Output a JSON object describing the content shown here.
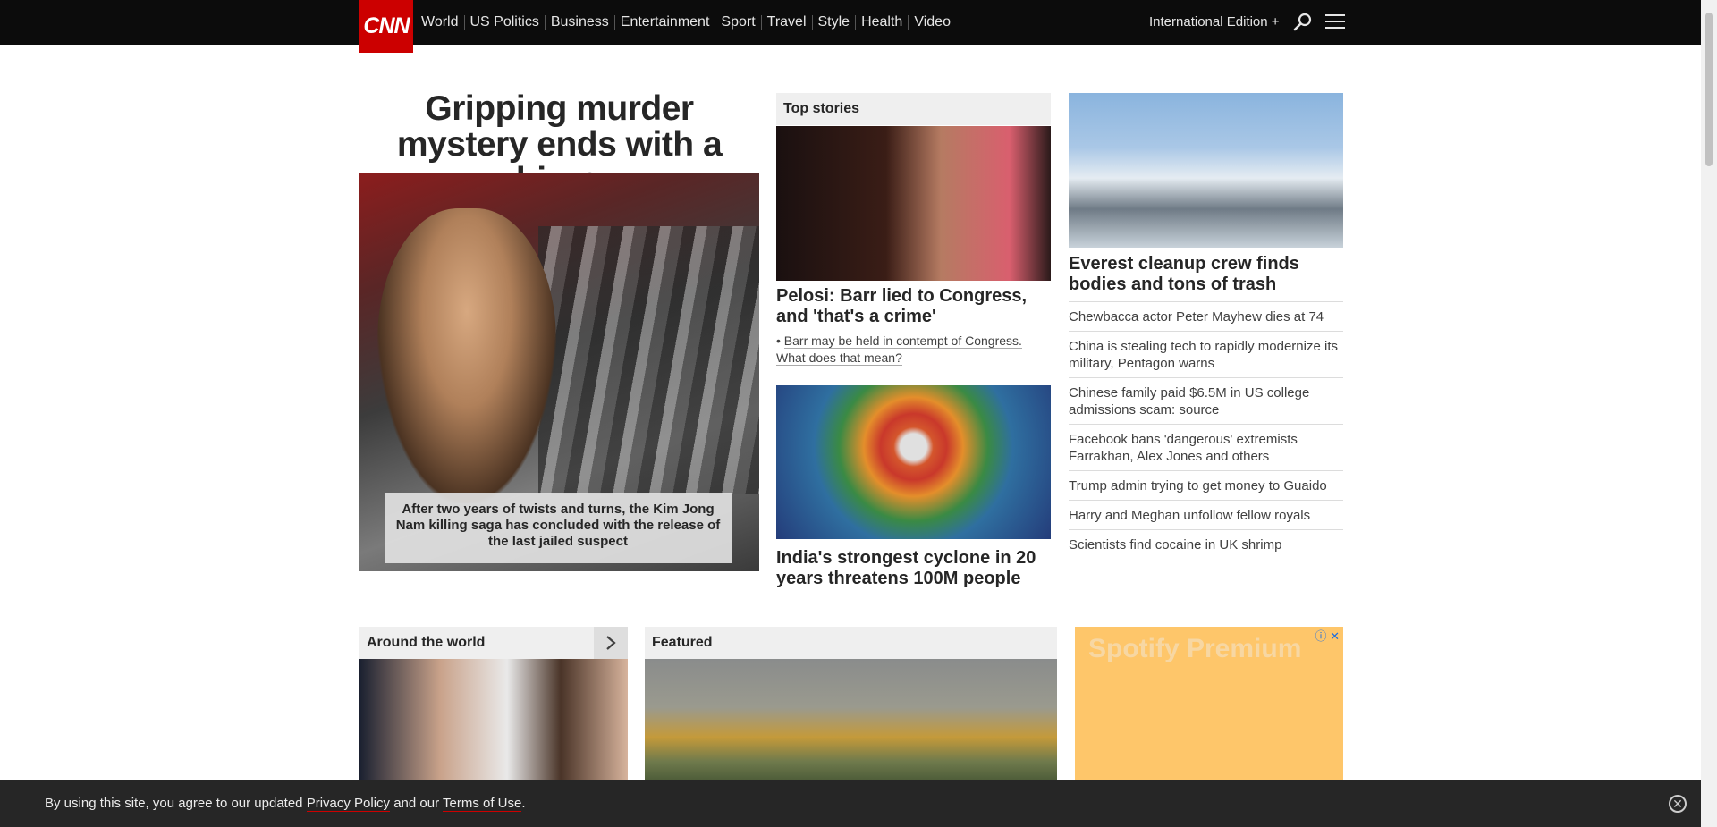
{
  "header": {
    "logo": "CNN",
    "nav": [
      "World",
      "US Politics",
      "Business",
      "Entertainment",
      "Sport",
      "Travel",
      "Style",
      "Health",
      "Video"
    ],
    "edition": "International Edition +"
  },
  "hero": {
    "title": "Gripping murder mystery ends with a whimper",
    "caption": "After two years of twists and turns, the Kim Jong Nam killing saga has concluded with the release of the last jailed suspect"
  },
  "top_stories": {
    "label": "Top stories",
    "lead_headline": "Pelosi: Barr lied to Congress, and 'that's a crime'",
    "lead_sublink": "Barr may be held in contempt of Congress. What does that mean?",
    "second_headline": "India's strongest cyclone in 20 years threatens 100M people"
  },
  "right_column": {
    "headline": "Everest cleanup crew finds bodies and tons of trash",
    "stories": [
      "Chewbacca actor Peter Mayhew dies at 74",
      "China is stealing tech to rapidly modernize its military, Pentagon warns",
      "Chinese family paid $6.5M in US college admissions scam: source",
      "Facebook bans 'dangerous' extremists Farrakhan, Alex Jones and others",
      "Trump admin trying to get money to Guaido",
      "Harry and Meghan unfollow fellow royals",
      "Scientists find cocaine in UK shrimp"
    ]
  },
  "sections": {
    "around_the_world": "Around the world",
    "featured": "Featured"
  },
  "ad": {
    "text": "Spotify Premium",
    "icons": "ⓘ ✕"
  },
  "cookie": {
    "text_1": "By using this site, you agree to our updated ",
    "privacy": "Privacy Policy",
    "text_2": " and our ",
    "terms": "Terms of Use",
    "text_3": "."
  },
  "colors": {
    "brand_red": "#cc0000",
    "nav_bg": "#0c0c0c",
    "ad_bg": "#fec66a"
  }
}
